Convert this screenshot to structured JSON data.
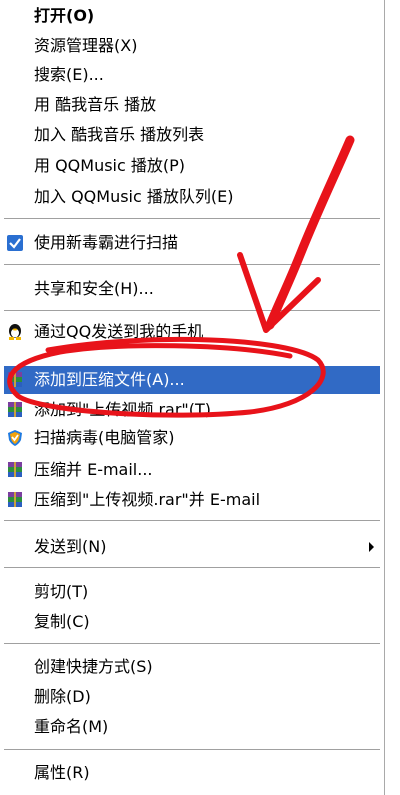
{
  "menu": {
    "items": [
      {
        "label": "打开(O)",
        "icon": null
      },
      {
        "label": "资源管理器(X)",
        "icon": null
      },
      {
        "label": "搜索(E)...",
        "icon": null
      },
      {
        "label": "用 酷我音乐 播放",
        "icon": null
      },
      {
        "label": "加入 酷我音乐 播放列表",
        "icon": null
      },
      {
        "label": "用 QQMusic 播放(P)",
        "icon": null
      },
      {
        "label": "加入 QQMusic 播放队列(E)",
        "icon": null
      },
      {
        "label": "使用新毒霸进行扫描",
        "icon": "duba-shield-icon"
      },
      {
        "label": "共享和安全(H)...",
        "icon": null
      },
      {
        "label": "通过QQ发送到我的手机",
        "icon": "qq-penguin-icon"
      },
      {
        "label": "添加到压缩文件(A)...",
        "icon": "winrar-books-icon"
      },
      {
        "label": "添加到\"上传视频.rar\"(T)",
        "icon": "winrar-books-icon"
      },
      {
        "label": "扫描病毒(电脑管家)",
        "icon": "tencent-shield-icon"
      },
      {
        "label": "压缩并 E-mail...",
        "icon": "winrar-books-icon"
      },
      {
        "label": "压缩到\"上传视频.rar\"并 E-mail",
        "icon": "winrar-books-icon"
      },
      {
        "label": "发送到(N)",
        "icon": null
      },
      {
        "label": "剪切(T)",
        "icon": null
      },
      {
        "label": "复制(C)",
        "icon": null
      },
      {
        "label": "创建快捷方式(S)",
        "icon": null
      },
      {
        "label": "删除(D)",
        "icon": null
      },
      {
        "label": "重命名(M)",
        "icon": null
      },
      {
        "label": "属性(R)",
        "icon": null
      }
    ],
    "highlight_color": "#316ac5",
    "annotation_color": "#e8131a"
  }
}
